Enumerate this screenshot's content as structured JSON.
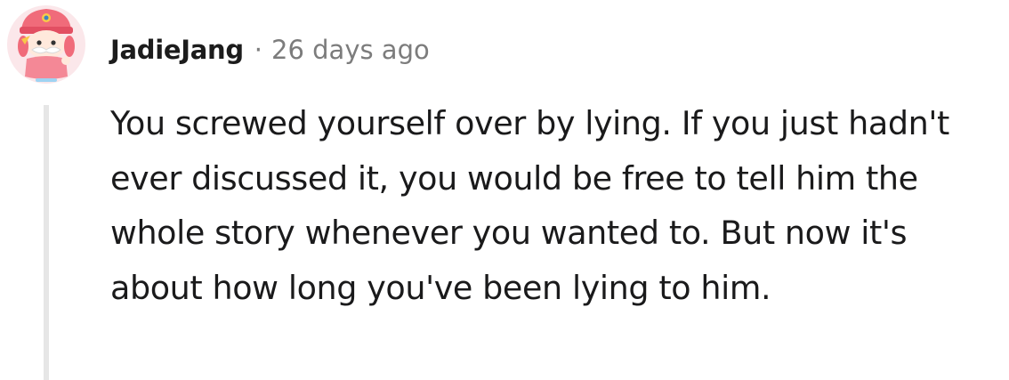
{
  "comment": {
    "author": "JadieJang",
    "separator": "·",
    "timestamp": "26 days ago",
    "body": "You screwed yourself over by lying. If you just hadn't ever discussed it, you would be free to tell him the whole story whenever you wanted to. But now it's about how long you've been lying to him.",
    "avatar_icon": "cartoon-character-avatar"
  },
  "colors": {
    "text": "#1a1a1b",
    "meta": "#7c7c7c",
    "thread_line": "#e6e6e6",
    "avatar_pink": "#f06b7a"
  }
}
